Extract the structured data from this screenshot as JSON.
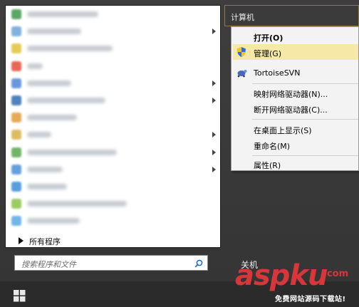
{
  "start_menu": {
    "programs": [
      {
        "icon": "green-app-icon",
        "color": "#3d9a4a",
        "has_submenu": false
      },
      {
        "icon": "flash-fxp-icon",
        "color": "#6aa5d8",
        "has_submenu": true
      },
      {
        "icon": "yellow-app-icon",
        "color": "#e2c33a",
        "has_submenu": false
      },
      {
        "icon": "qq-icon",
        "color": "#e44d3a",
        "has_submenu": false
      },
      {
        "icon": "blue-app-icon",
        "color": "#4f86d9",
        "has_submenu": true
      },
      {
        "icon": "photoshop-icon",
        "color": "#2f6fb3",
        "has_submenu": true
      },
      {
        "icon": "orange-app-icon",
        "color": "#e39a3c",
        "has_submenu": false
      },
      {
        "icon": "folder-icon",
        "color": "#d7b24a",
        "has_submenu": true
      },
      {
        "icon": "vmware-icon",
        "color": "#5aa84f",
        "has_submenu": true
      },
      {
        "icon": "network-app-icon",
        "color": "#4d8fd8",
        "has_submenu": true
      },
      {
        "icon": "globe-icon",
        "color": "#3b8ed6",
        "has_submenu": false
      },
      {
        "icon": "colorful-app-icon",
        "color": "#8bc34a",
        "has_submenu": false
      },
      {
        "icon": "ie-icon",
        "color": "#5aa9e6",
        "has_submenu": false
      }
    ],
    "all_programs_label": "所有程序",
    "search_placeholder": "搜索程序和文件",
    "computer_label": "计算机",
    "shutdown_label": "关机"
  },
  "context_menu": {
    "items": [
      {
        "label": "打开(O)",
        "bold": true,
        "highlighted": false,
        "icon": null
      },
      {
        "label": "管理(G)",
        "bold": false,
        "highlighted": true,
        "icon": "shield-icon"
      },
      {
        "label": "TortoiseSVN",
        "bold": false,
        "highlighted": false,
        "icon": "tortoise-svn-icon"
      },
      {
        "label": "映射网络驱动器(N)...",
        "bold": false,
        "highlighted": false,
        "icon": null
      },
      {
        "label": "断开网络驱动器(C)...",
        "bold": false,
        "highlighted": false,
        "icon": null
      },
      {
        "label": "在桌面上显示(S)",
        "bold": false,
        "highlighted": false,
        "icon": null
      },
      {
        "label": "重命名(M)",
        "bold": false,
        "highlighted": false,
        "icon": null
      },
      {
        "label": "属性(R)",
        "bold": false,
        "highlighted": false,
        "icon": null
      }
    ]
  },
  "watermark": {
    "logo": "aspku",
    "domain": ".com",
    "tagline": "免费网站源码下载站!"
  },
  "colors": {
    "menu_background": "#3a3a3a",
    "highlight": "#f6e9a7",
    "watermark_red": "#d9363b"
  }
}
